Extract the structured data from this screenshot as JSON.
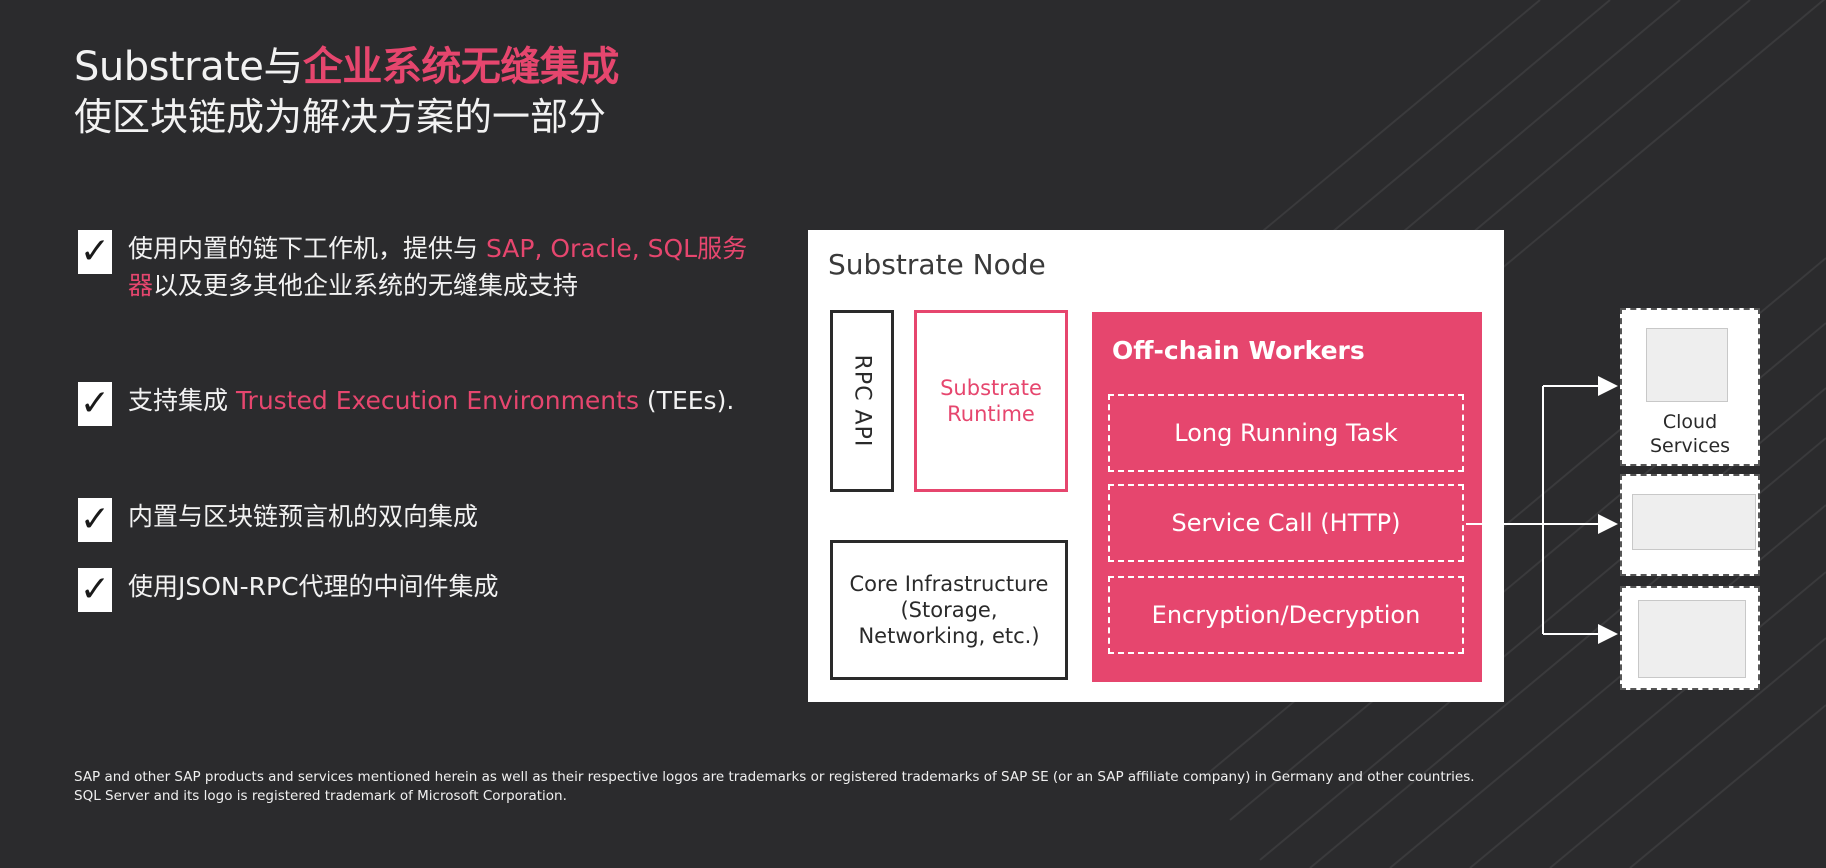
{
  "title": {
    "line1_plain": "Substrate与",
    "line1_accent": "企业系统无缝集成",
    "line2": "使区块链成为解决方案的一部分"
  },
  "bullets": [
    {
      "check": "✓",
      "text_before": "使用内置的链下工作机，提供与 ",
      "text_highlight": "SAP, Oracle, SQL服务器",
      "text_after": "以及更多其他企业系统的无缝集成支持"
    },
    {
      "check": "✓",
      "text_before": "支持集成 ",
      "text_highlight": "Trusted Execution Environments",
      "text_after": " (TEEs)."
    },
    {
      "check": "✓",
      "text": "内置与区块链预言机的双向集成"
    },
    {
      "check": "✓",
      "text": "使用JSON-RPC代理的中间件集成"
    }
  ],
  "diagram": {
    "node_title": "Substrate Node",
    "rpc_api": "RPC API",
    "runtime": [
      "Substrate",
      "Runtime"
    ],
    "core": [
      "Core Infrastructure",
      "(Storage,",
      "Networking, etc.)"
    ],
    "ocw_title": "Off-chain Workers",
    "tasks": [
      "Long Running Task",
      "Service Call (HTTP)",
      "Encryption/Decryption"
    ],
    "cloud_label": [
      "Cloud",
      "Services"
    ]
  },
  "footer": {
    "line1": "SAP and other SAP products and services mentioned herein as well as their respective logos are trademarks or registered trademarks of SAP SE (or an SAP affiliate company) in Germany and other countries.",
    "line2": "SQL Server and its logo is registered trademark of Microsoft Corporation."
  },
  "colors": {
    "background": "#2b2b2d",
    "accent": "#e6466e",
    "text": "#f2f2f2"
  }
}
